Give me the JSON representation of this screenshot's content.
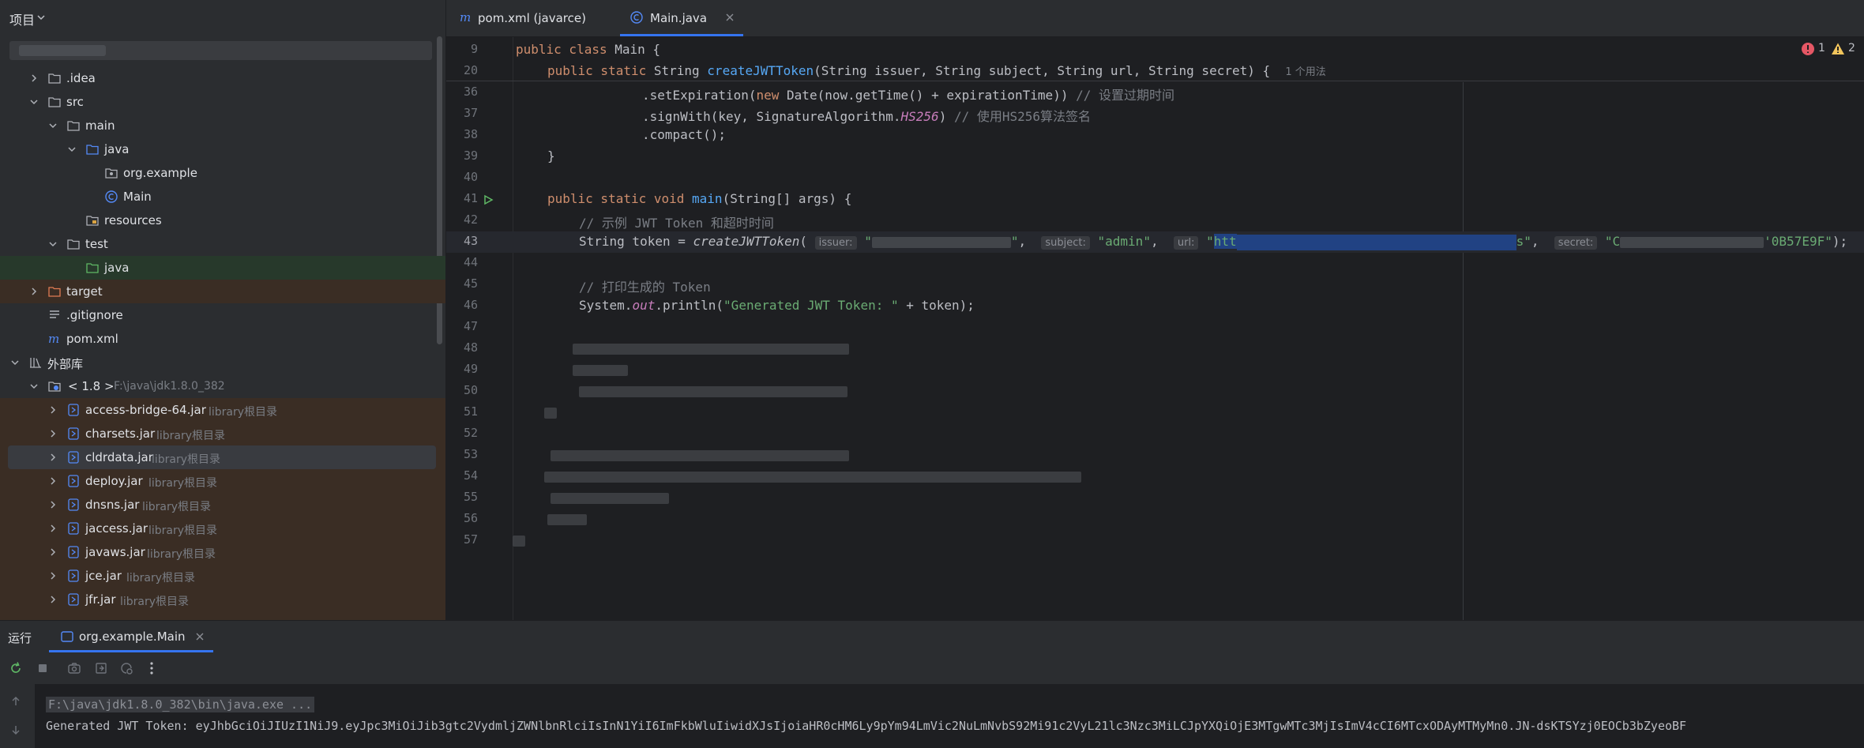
{
  "project": {
    "title": "项目",
    "tree": [
      {
        "label": ".idea"
      },
      {
        "label": "src"
      },
      {
        "label": "main"
      },
      {
        "label": "java"
      },
      {
        "label": "org.example"
      },
      {
        "label": "Main"
      },
      {
        "label": "resources"
      },
      {
        "label": "test"
      },
      {
        "label": "java"
      },
      {
        "label": "target"
      },
      {
        "label": ".gitignore"
      },
      {
        "label": "pom.xml"
      },
      {
        "label": "外部库"
      },
      {
        "label": "< 1.8 >",
        "hint": "F:\\java\\jdk1.8.0_382"
      },
      {
        "label": "access-bridge-64.jar",
        "hint": "library根目录"
      },
      {
        "label": "charsets.jar",
        "hint": "library根目录"
      },
      {
        "label": "cldrdata.jar",
        "hint": "library根目录"
      },
      {
        "label": "deploy.jar",
        "hint": "library根目录"
      },
      {
        "label": "dnsns.jar",
        "hint": "library根目录"
      },
      {
        "label": "jaccess.jar",
        "hint": "library根目录"
      },
      {
        "label": "javaws.jar",
        "hint": "library根目录"
      },
      {
        "label": "jce.jar",
        "hint": "library根目录"
      },
      {
        "label": "jfr.jar",
        "hint": "library根目录"
      }
    ]
  },
  "tabs": [
    {
      "label": "pom.xml (javarce)"
    },
    {
      "label": "Main.java"
    }
  ],
  "editor": {
    "errors": "1",
    "warnings": "2",
    "line_numbers": [
      "9",
      "20",
      "36",
      "37",
      "38",
      "39",
      "40",
      "41",
      "42",
      "43",
      "44",
      "45",
      "46",
      "47",
      "48",
      "49",
      "50",
      "51",
      "52",
      "53",
      "54",
      "55",
      "56",
      "57"
    ],
    "sticky1": {
      "kw": "public class",
      "rest": " Main {"
    },
    "sticky2": {
      "kw1": "public static",
      "type": " String ",
      "fn": "createJWTToken",
      "params": "(String issuer, String subject, String url, String secret) {",
      "usage": "1 个用法"
    },
    "l36": {
      "a": ".setExpiration(",
      "kw": "new",
      "b": " Date(now.getTime() + expirationTime))",
      "cmt": " // 设置过期时间"
    },
    "l37": {
      "a": ".signWith(key, SignatureAlgorithm.",
      "c": "HS256",
      "b": ")",
      "cmt": " // 使用HS256算法签名"
    },
    "l38": ".compact();",
    "l39": "}",
    "l41": {
      "kw": "public static void",
      "fn": "main",
      "rest": "(String[] args) {"
    },
    "l42": "// 示例 JWT Token 和超时时间",
    "l43": {
      "a": "String token = ",
      "call": "createJWTToken",
      "p": "(",
      "h_issuer": "issuer:",
      "s_issuer_start": "\"",
      "s_issuer_end": "\"",
      "h_subject": "subject:",
      "s_subject": "\"admin\"",
      "h_url": "url:",
      "s_url_q": "\"",
      "s_url_sel": "htt",
      "s_url_end": "s\"",
      "h_secret": "secret:",
      "s_secret_start": "\"C",
      "s_secret_end": "'0B57E9F\"",
      "end": ");"
    },
    "l45": "// 打印生成的 Token",
    "l46": {
      "a": "System.",
      "out": "out",
      "b": ".println(",
      "str": "\"Generated JWT Token: \"",
      "c": " + token);"
    }
  },
  "run": {
    "title": "运行",
    "tab": "org.example.Main",
    "cmd": "F:\\java\\jdk1.8.0_382\\bin\\java.exe ...",
    "output": "Generated JWT Token: eyJhbGciOiJIUzI1NiJ9.eyJpc3MiOiJib3gtc2VydmljZWNlbnRlciIsInN1YiI6ImFkbWluIiwidXJsIjoiaHR0cHM6Ly9pYm94LmVic2NuLmNvbS92Mi91c2VyL21lc3Nzc3MiLCJpYXQiOjE3MTgwMTc3MjIsImV4cCI6MTcxODAyMTMyMn0.JN-dsKTSYzj0EOCb3bZyeoBF"
  },
  "colors": {
    "accent": "#3574f0",
    "error": "#e55765",
    "warning": "#f2c55c",
    "run": "#5fb865"
  }
}
